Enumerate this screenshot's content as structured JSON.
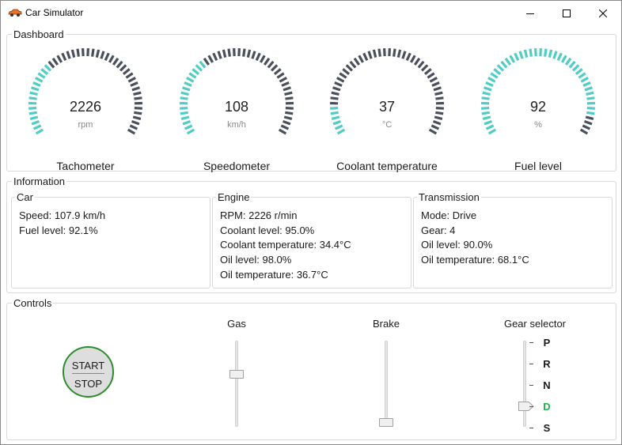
{
  "window": {
    "title": "Car Simulator",
    "icon": "car-icon",
    "controls": [
      "minimize-icon",
      "maximize-icon",
      "close-icon"
    ]
  },
  "dashboard": {
    "label": "Dashboard",
    "gauges": [
      {
        "value": "2226",
        "unit": "rpm",
        "title": "Tachometer",
        "fill_fraction": 0.32
      },
      {
        "value": "108",
        "unit": "km/h",
        "title": "Speedometer",
        "fill_fraction": 0.35
      },
      {
        "value": "37",
        "unit": "°C",
        "title": "Coolant temperature",
        "fill_fraction": 0.12
      },
      {
        "value": "92",
        "unit": "%",
        "title": "Fuel level",
        "fill_fraction": 0.92
      }
    ],
    "colors": {
      "active": "#4ecdc4",
      "inactive": "#4a4f5c"
    }
  },
  "information": {
    "label": "Information",
    "car": {
      "label": "Car",
      "lines": [
        "Speed: 107.9 km/h",
        "Fuel level: 92.1%"
      ]
    },
    "engine": {
      "label": "Engine",
      "lines": [
        "RPM: 2226 r/min",
        "Coolant level: 95.0%",
        "Coolant temperature: 34.4°C",
        "Oil level: 98.0%",
        "Oil temperature: 36.7°C"
      ]
    },
    "transmission": {
      "label": "Transmission",
      "lines": [
        "Mode: Drive",
        "Gear: 4",
        "Oil level: 90.0%",
        "Oil temperature: 68.1°C"
      ]
    }
  },
  "controls": {
    "label": "Controls",
    "start_stop": {
      "top": "START",
      "bottom": "STOP",
      "accent": "#2e8b2e"
    },
    "gas": {
      "label": "Gas",
      "level": 0.62
    },
    "brake": {
      "label": "Brake",
      "level": 0.0
    },
    "gear_selector": {
      "label": "Gear selector",
      "options": [
        "P",
        "R",
        "N",
        "D",
        "S"
      ],
      "selected": "D",
      "selected_color": "#22b14c"
    }
  }
}
